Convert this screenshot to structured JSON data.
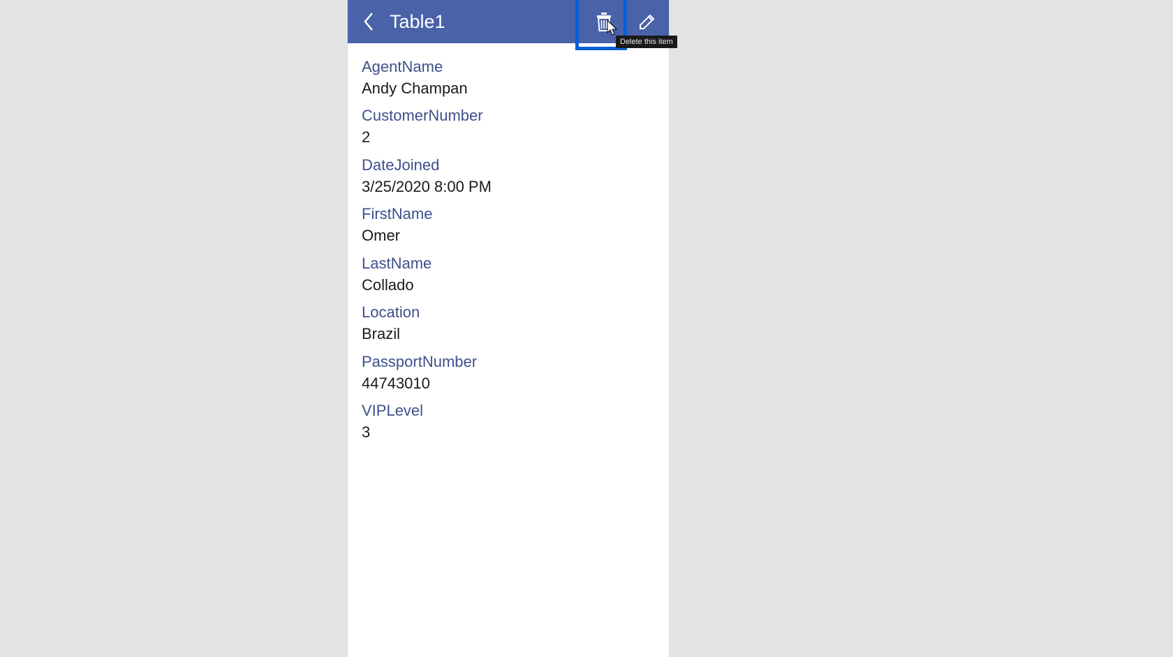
{
  "header": {
    "title": "Table1",
    "tooltip": "Delete this item"
  },
  "fields": [
    {
      "label": "AgentName",
      "value": "Andy Champan"
    },
    {
      "label": "CustomerNumber",
      "value": "2"
    },
    {
      "label": "DateJoined",
      "value": "3/25/2020 8:00 PM"
    },
    {
      "label": "FirstName",
      "value": "Omer"
    },
    {
      "label": "LastName",
      "value": "Collado"
    },
    {
      "label": "Location",
      "value": "Brazil"
    },
    {
      "label": "PassportNumber",
      "value": "44743010"
    },
    {
      "label": "VIPLevel",
      "value": "3"
    }
  ]
}
